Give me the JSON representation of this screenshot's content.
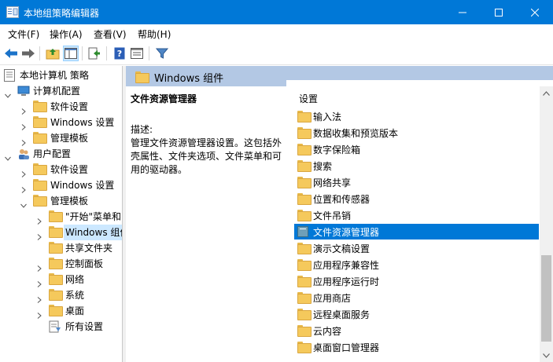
{
  "window": {
    "title": "本地组策略编辑器"
  },
  "menu": [
    {
      "label": "文件(F)"
    },
    {
      "label": "操作(A)"
    },
    {
      "label": "查看(V)"
    },
    {
      "label": "帮助(H)"
    }
  ],
  "tree": {
    "root": "本地计算机 策略",
    "computer_config": "计算机配置",
    "cc_software": "软件设置",
    "cc_windows": "Windows 设置",
    "cc_admin": "管理模板",
    "user_config": "用户配置",
    "uc_software": "软件设置",
    "uc_windows": "Windows 设置",
    "uc_admin": "管理模板",
    "start_menu": "\"开始\"菜单和",
    "windows_components": "Windows 组件",
    "shared_folders": "共享文件夹",
    "control_panel": "控制面板",
    "network": "网络",
    "system": "系统",
    "desktop": "桌面",
    "all_settings": "所有设置"
  },
  "right": {
    "header": "Windows 组件",
    "desc_heading": "文件资源管理器",
    "desc_label": "描述:",
    "desc_body": "管理文件资源管理器设置。这包括外壳属性、文件夹选项、文件菜单和可用的驱动器。",
    "settings_header": "设置",
    "items": [
      {
        "label": "输入法"
      },
      {
        "label": "数据收集和预览版本"
      },
      {
        "label": "数字保险箱"
      },
      {
        "label": "搜索"
      },
      {
        "label": "网络共享"
      },
      {
        "label": "位置和传感器"
      },
      {
        "label": "文件吊销"
      },
      {
        "label": "文件资源管理器"
      },
      {
        "label": "演示文稿设置"
      },
      {
        "label": "应用程序兼容性"
      },
      {
        "label": "应用程序运行时"
      },
      {
        "label": "应用商店"
      },
      {
        "label": "远程桌面服务"
      },
      {
        "label": "云内容"
      },
      {
        "label": "桌面窗口管理器"
      }
    ]
  },
  "colors": {
    "title_bar": "#0078d7",
    "selection": "#0078d7",
    "pane_header": "#b3c8e4"
  }
}
